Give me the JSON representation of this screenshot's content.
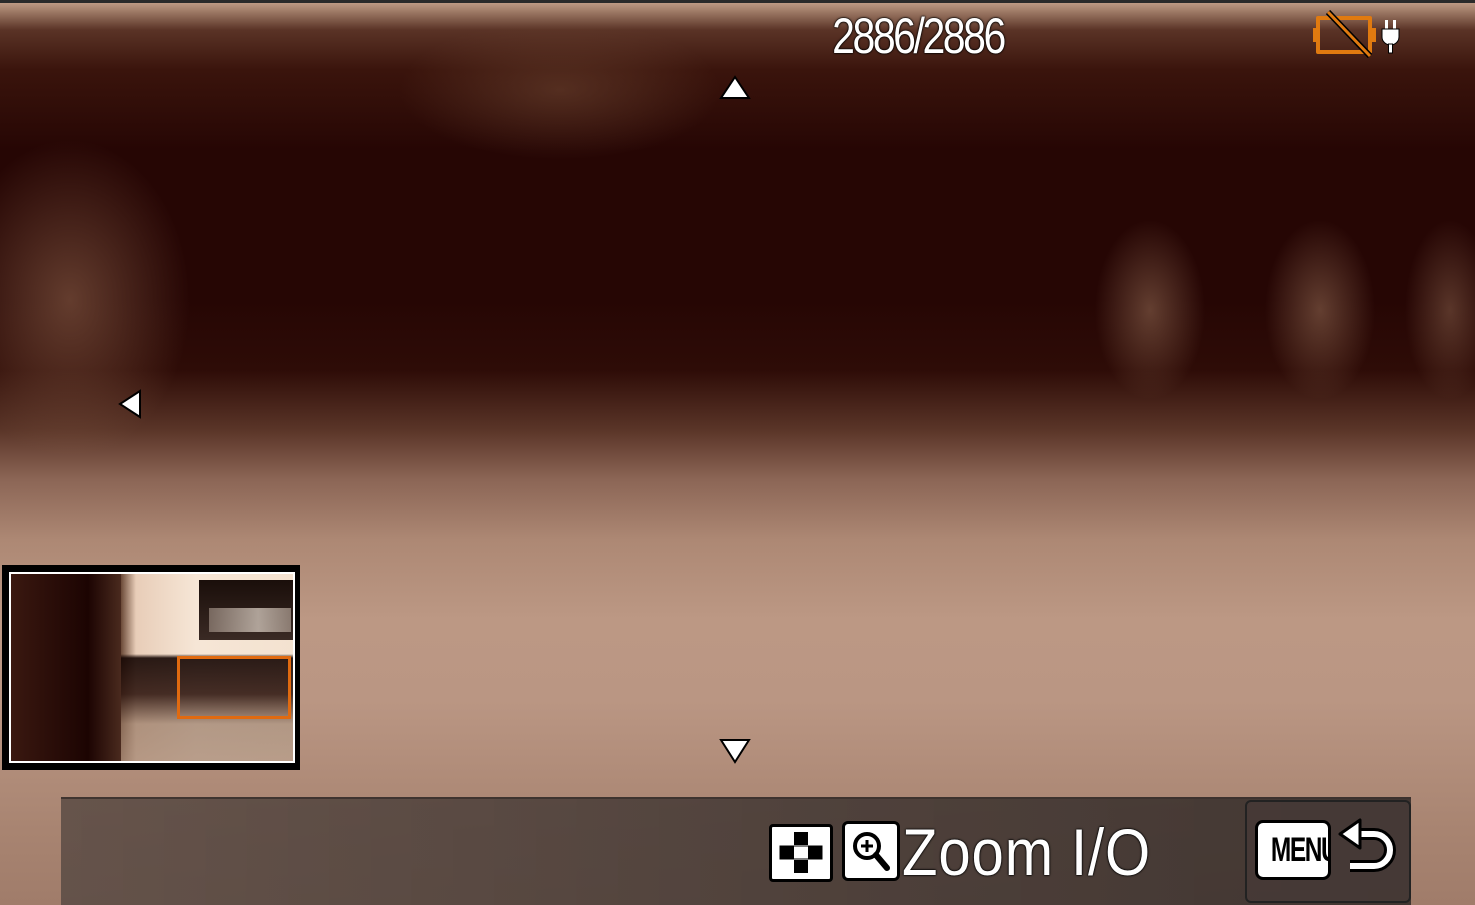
{
  "viewer": {
    "image_counter": "2886/2886"
  },
  "status": {
    "battery_icon": "battery-empty-icon",
    "power_icon": "ac-power-plug-icon",
    "battery_color": "#e07a10"
  },
  "navigation": {
    "up_icon": "pan-up-arrow-icon",
    "down_icon": "pan-down-arrow-icon",
    "left_icon": "pan-left-arrow-icon"
  },
  "zoom_navigator": {
    "frame_color": "#e06a10"
  },
  "bottom_bar": {
    "grid_icon": "image-index-icon",
    "zoom_icon": "zoom-magnifier-icon",
    "zoom_label": "Zoom I/O",
    "menu_label": "MENU",
    "return_icon": "return-arrow-icon"
  }
}
